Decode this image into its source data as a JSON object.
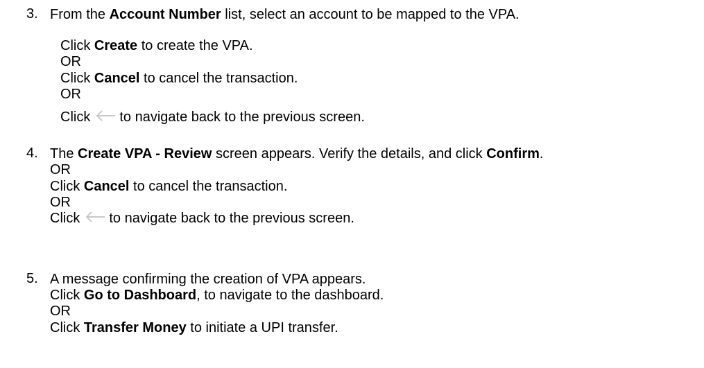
{
  "steps": [
    {
      "number": "3.",
      "intro": {
        "pre": "From the ",
        "bold": "Account Number",
        "post": " list, select an account to be mapped to the VPA."
      },
      "create": {
        "pre": "Click ",
        "bold": "Create",
        "post": " to create the VPA."
      },
      "or1": "OR",
      "cancel": {
        "pre": "Click ",
        "bold": "Cancel",
        "post": " to cancel the transaction."
      },
      "or2": "OR",
      "back": {
        "pre": "Click",
        "post": "to navigate back to the previous screen."
      }
    },
    {
      "number": "4.",
      "intro": {
        "pre": "The ",
        "bold": "Create VPA - Review",
        "mid": " screen appears. Verify the details, and click ",
        "bold2": "Confirm",
        "post": "."
      },
      "or1": "OR",
      "cancel": {
        "pre": "Click ",
        "bold": "Cancel",
        "post": " to cancel the transaction."
      },
      "or2": "OR",
      "back": {
        "pre": "Click",
        "post": "to navigate back to the previous screen."
      }
    },
    {
      "number": "5.",
      "intro": {
        "text": "A message confirming the creation of VPA appears."
      },
      "dashboard": {
        "pre": "Click ",
        "bold": "Go to Dashboard",
        "post": ", to navigate to the dashboard."
      },
      "or1": "OR",
      "transfer": {
        "pre": "Click ",
        "bold": "Transfer Money",
        "post": " to initiate a UPI transfer."
      }
    }
  ],
  "icons": {
    "back": "back-arrow-icon"
  },
  "colors": {
    "text": "#000000",
    "icon": "#c8c8c8"
  }
}
